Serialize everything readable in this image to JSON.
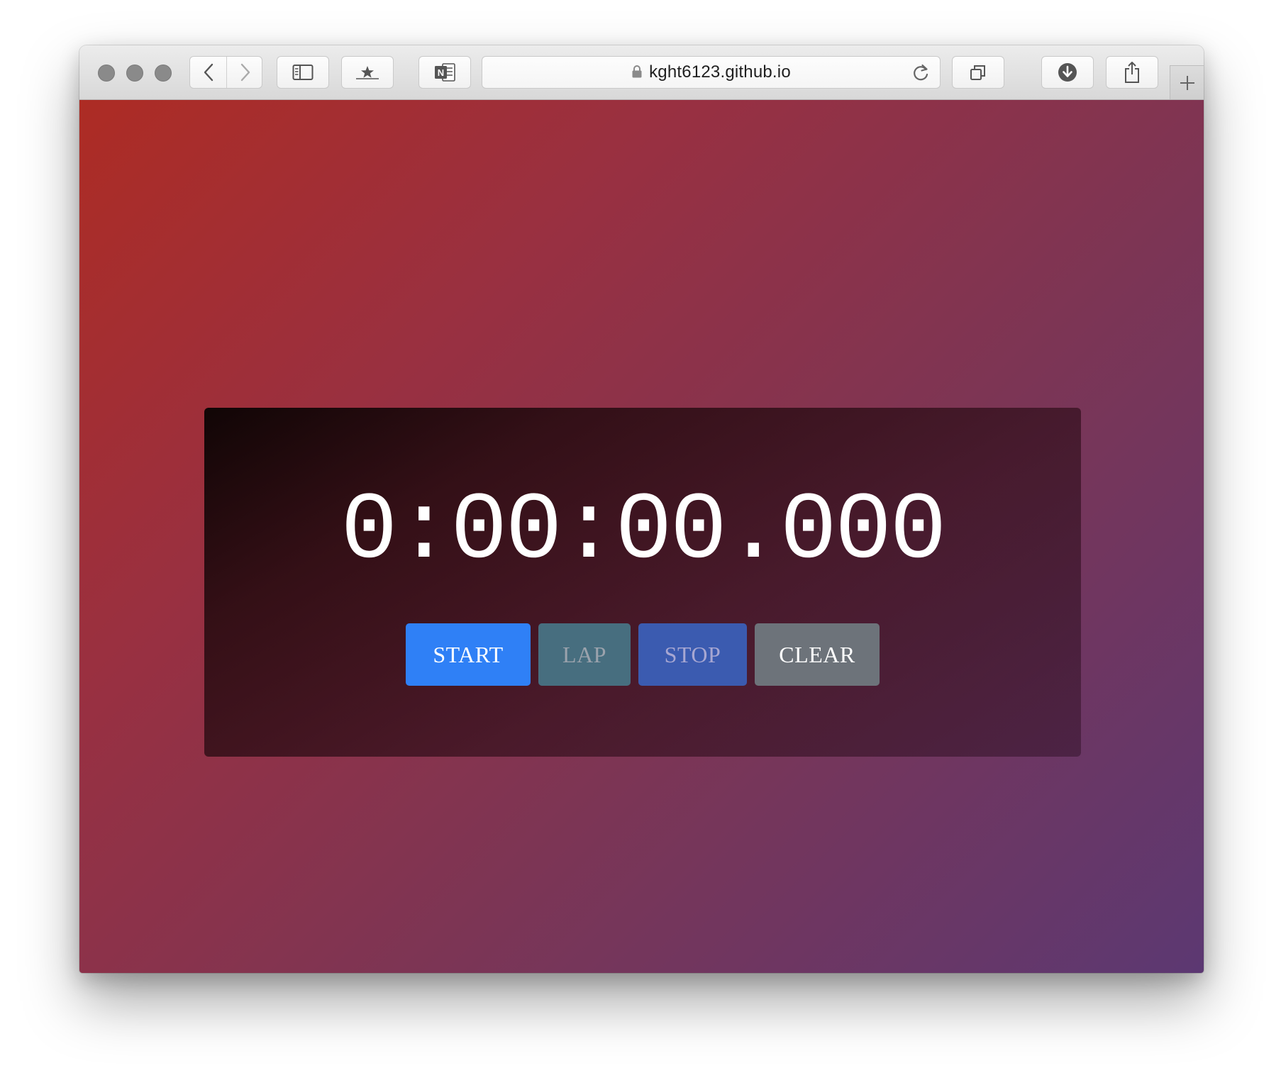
{
  "browser": {
    "url": "kght6123.github.io",
    "toolbar_icons": [
      "back-icon",
      "forward-icon",
      "sidebar-icon",
      "bookmarks-icon",
      "onenote-icon",
      "lock-icon",
      "reload-icon",
      "tabs-overview-icon",
      "download-icon",
      "share-icon",
      "new-tab-icon"
    ],
    "onenote_letter": "N"
  },
  "stopwatch": {
    "time": "0:00:00.000",
    "buttons": {
      "start": "START",
      "lap": "LAP",
      "stop": "STOP",
      "clear": "CLEAR"
    }
  },
  "colors": {
    "start_button": "#2f80f6",
    "lap_button": "#476e7f",
    "stop_button": "#3b5bb0",
    "clear_button": "#6d737a",
    "background_top_left": "#ad2c24",
    "background_bottom_right": "#5c3872"
  }
}
